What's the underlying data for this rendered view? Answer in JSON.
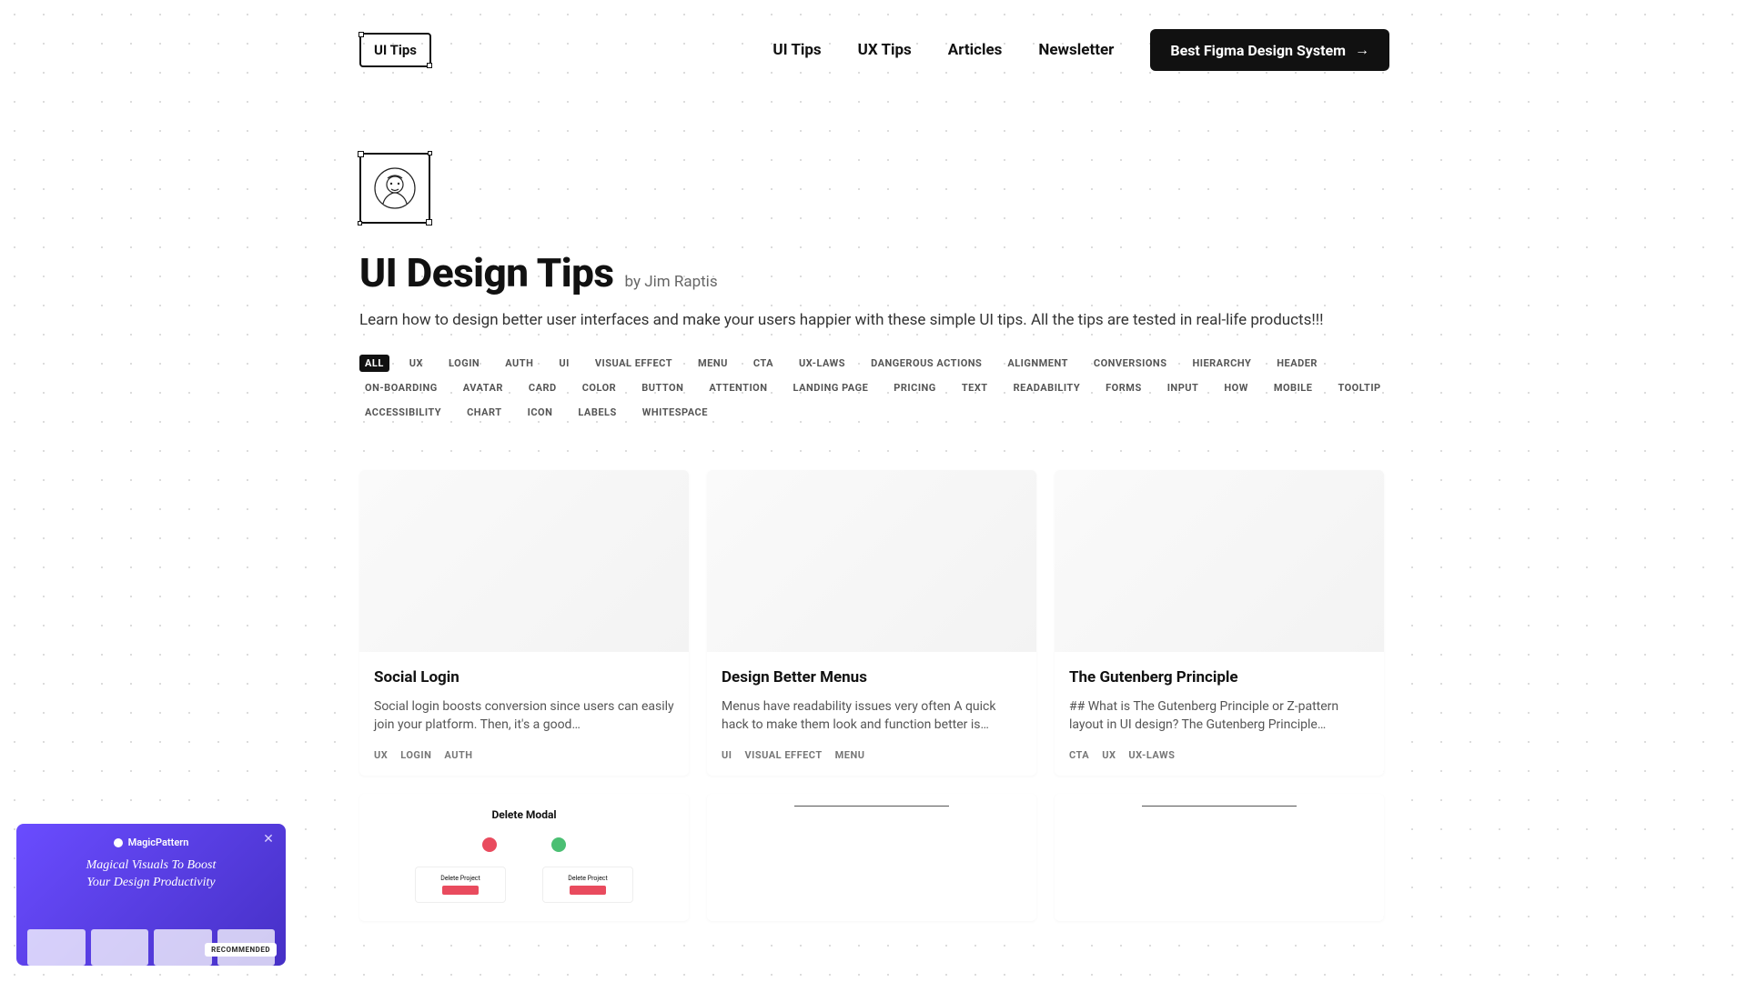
{
  "header": {
    "logo": "UI Tips",
    "nav": [
      "UI Tips",
      "UX Tips",
      "Articles",
      "Newsletter"
    ],
    "cta": "Best Figma Design System"
  },
  "hero": {
    "title": "UI Design Tips",
    "byline": "by Jim Raptis",
    "subtitle": "Learn how to design better user interfaces and make your users happier with these simple UI tips. All the tips are tested in real-life products!!!"
  },
  "tags": [
    "ALL",
    "UX",
    "LOGIN",
    "AUTH",
    "UI",
    "VISUAL EFFECT",
    "MENU",
    "CTA",
    "UX-LAWS",
    "DANGEROUS ACTIONS",
    "ALIGNMENT",
    "CONVERSIONS",
    "HIERARCHY",
    "HEADER",
    "ON-BOARDING",
    "AVATAR",
    "CARD",
    "COLOR",
    "BUTTON",
    "ATTENTION",
    "LANDING PAGE",
    "PRICING",
    "TEXT",
    "READABILITY",
    "FORMS",
    "INPUT",
    "HOW",
    "MOBILE",
    "TOOLTIP",
    "ACCESSIBILITY",
    "CHART",
    "ICON",
    "LABELS",
    "WHITESPACE"
  ],
  "tags_active_index": 0,
  "cards": [
    {
      "title": "Social Login",
      "desc": "Social login boosts conversion since users can easily join your platform. Then, it's a good…",
      "tags": [
        "UX",
        "LOGIN",
        "AUTH"
      ]
    },
    {
      "title": "Design Better Menus",
      "desc": "Menus have readability issues very often A quick hack to make them look and function better is…",
      "tags": [
        "UI",
        "VISUAL EFFECT",
        "MENU"
      ]
    },
    {
      "title": "The Gutenberg Principle",
      "desc": "## What is The Gutenberg Principle or Z-pattern layout in UI design? The Gutenberg Principle…",
      "tags": [
        "CTA",
        "UX",
        "UX-LAWS"
      ]
    }
  ],
  "row2": {
    "delete_header": "Delete Modal",
    "panel_label": "Delete Project"
  },
  "promo": {
    "brand": "MagicPattern",
    "slogan_line1": "Magical Visuals To Boost",
    "slogan_line2": "Your Design Productivity",
    "badge": "RECOMMENDED"
  }
}
